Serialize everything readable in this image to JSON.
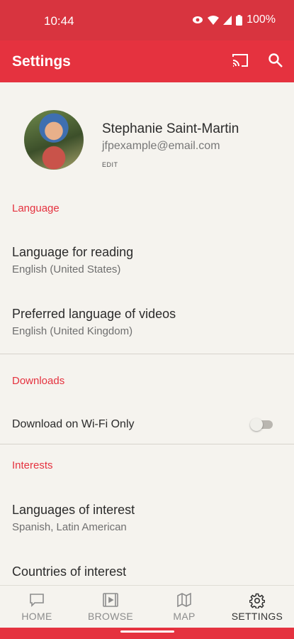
{
  "status": {
    "time": "10:44",
    "battery": "100%"
  },
  "appbar": {
    "title": "Settings",
    "cast_icon": "cast-icon",
    "search_icon": "search-icon"
  },
  "profile": {
    "name": "Stephanie Saint-Martin",
    "email": "jfpexample@email.com",
    "edit": "EDIT"
  },
  "sections": {
    "language": {
      "header": "Language",
      "items": [
        {
          "title": "Language for reading",
          "value": "English (United States)"
        },
        {
          "title": "Preferred language of videos",
          "value": "English (United Kingdom)"
        }
      ]
    },
    "downloads": {
      "header": "Downloads",
      "wifi_only_label": "Download on Wi-Fi Only",
      "wifi_only_enabled": false
    },
    "interests": {
      "header": "Interests",
      "items": [
        {
          "title": "Languages of interest",
          "value": "Spanish, Latin American"
        },
        {
          "title": "Countries of interest",
          "value": ""
        }
      ]
    }
  },
  "bottom_nav": [
    {
      "label": "HOME",
      "icon": "home-icon",
      "active": false
    },
    {
      "label": "BROWSE",
      "icon": "browse-icon",
      "active": false
    },
    {
      "label": "MAP",
      "icon": "map-icon",
      "active": false
    },
    {
      "label": "SETTINGS",
      "icon": "settings-icon",
      "active": true
    }
  ],
  "colors": {
    "accent": "#e5323f",
    "status_bar": "#d8343f",
    "background": "#f5f3ee"
  }
}
